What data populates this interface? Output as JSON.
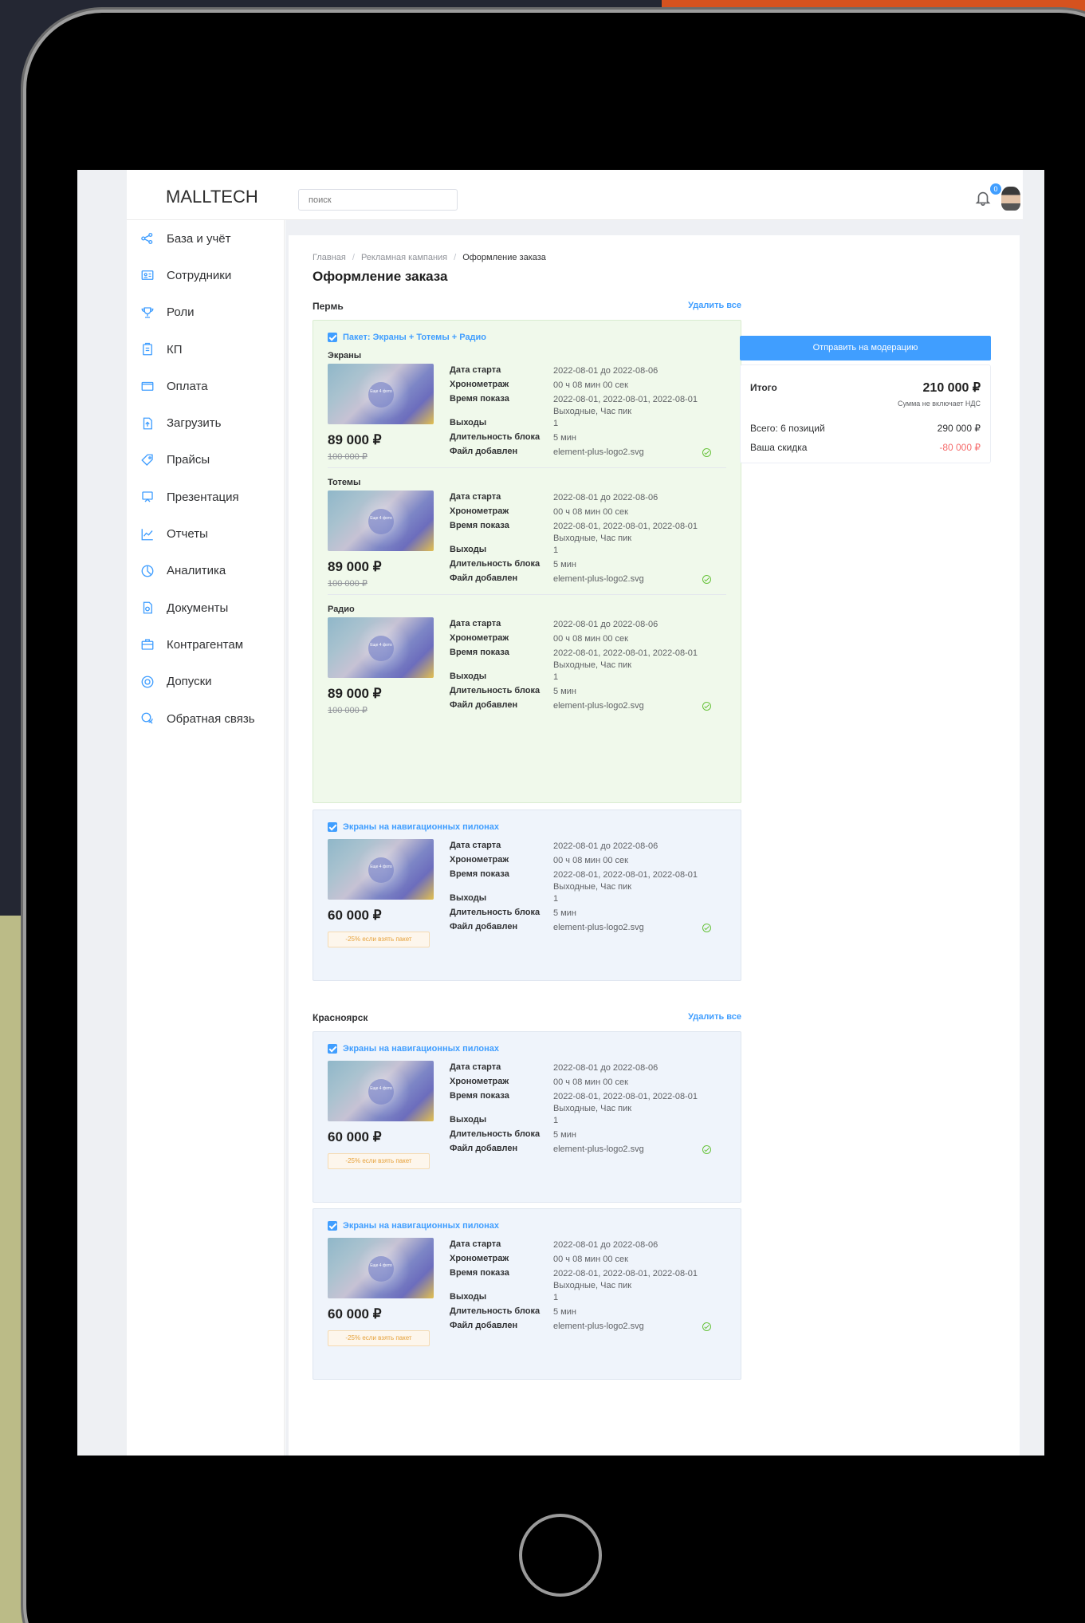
{
  "app": {
    "logo": "MALLTECH",
    "search_placeholder": "поиск",
    "notifications": "0"
  },
  "colors": {
    "primary": "#409eff",
    "success": "#67c23a",
    "danger": "#f56c6c",
    "warning": "#e6a23c"
  },
  "sidebar": {
    "items": [
      {
        "label": "База и учёт",
        "icon": "share-icon"
      },
      {
        "label": "Сотрудники",
        "icon": "id-card-icon"
      },
      {
        "label": "Роли",
        "icon": "trophy-icon"
      },
      {
        "label": "КП",
        "icon": "clipboard-icon"
      },
      {
        "label": "Оплата",
        "icon": "wallet-icon"
      },
      {
        "label": "Загрузить",
        "icon": "upload-icon"
      },
      {
        "label": "Прайсы",
        "icon": "price-tag-icon"
      },
      {
        "label": "Презентация",
        "icon": "presentation-icon"
      },
      {
        "label": "Отчеты",
        "icon": "chart-line-icon"
      },
      {
        "label": "Аналитика",
        "icon": "pie-chart-icon"
      },
      {
        "label": "Документы",
        "icon": "document-icon"
      },
      {
        "label": "Контрагентам",
        "icon": "briefcase-icon"
      },
      {
        "label": "Допуски",
        "icon": "coin-icon"
      },
      {
        "label": "Обратная связь",
        "icon": "chat-icon"
      }
    ]
  },
  "breadcrumbs": [
    "Главная",
    "Рекламная кампания",
    "Оформление заказа"
  ],
  "page_title": "Оформление заказа",
  "labels": {
    "date_start": "Дата старта",
    "duration": "Хронометраж",
    "show_time": "Время показа",
    "outputs": "Выходы",
    "block_length": "Длительность блока",
    "file_added": "Файл добавлен",
    "delete_all": "Удалить все",
    "thumb_text": "Еще 4 фото"
  },
  "values": {
    "date_start": "2022-08-01 до 2022-08-06",
    "duration": "00 ч 08 мин 00 сек",
    "show_time": "2022-08-01, 2022-08-01, 2022-08-01 Выходные, Час пик",
    "outputs": "1",
    "block_length": "5 мин",
    "file_added": "element-plus-logo2.svg"
  },
  "perm": {
    "city": "Пермь",
    "package_title": "Пакет: Экраны + Тотемы + Радио",
    "package_items": [
      {
        "name": "Экраны",
        "price": "89 000 ₽",
        "old_price": "100 000 ₽"
      },
      {
        "name": "Тотемы",
        "price": "89 000 ₽",
        "old_price": "100 000 ₽"
      },
      {
        "name": "Радио",
        "price": "89 000 ₽",
        "old_price": "100 000 ₽"
      }
    ],
    "single": {
      "title": "Экраны на навигационных пилонах",
      "price": "60 000 ₽",
      "promo": "-25% если взять пакет"
    }
  },
  "krasnoyarsk": {
    "city": "Красноярск",
    "items": [
      {
        "title": "Экраны на навигационных пилонах",
        "price": "60 000 ₽",
        "promo": "-25% если взять пакет"
      },
      {
        "title": "Экраны на навигационных пилонах",
        "price": "60 000 ₽",
        "promo": "-25% если взять пакет"
      }
    ]
  },
  "summary": {
    "submit": "Отправить на модерацию",
    "total_label": "Итого",
    "total": "210 000 ₽",
    "vat_note": "Сумма не включает НДС",
    "count_label": "Всего: 6 позиций",
    "count_value": "290 000 ₽",
    "discount_label": "Ваша скидка",
    "discount_value": "-80 000 ₽"
  }
}
